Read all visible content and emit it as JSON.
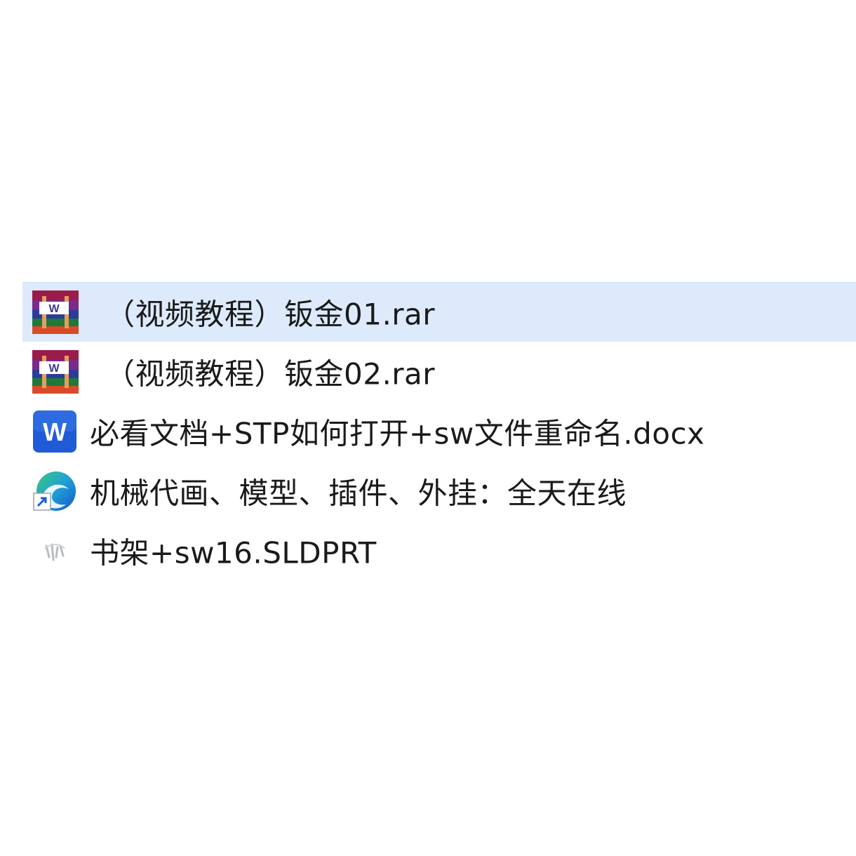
{
  "files": [
    {
      "name": "（视频教程）钣金01.rar",
      "icon": "winrar-archive-icon",
      "selected": true
    },
    {
      "name": "（视频教程）钣金02.rar",
      "icon": "winrar-archive-icon",
      "selected": false
    },
    {
      "name": "必看文档+STP如何打开+sw文件重命名.docx",
      "icon": "word-document-icon",
      "selected": false
    },
    {
      "name": "机械代画、模型、插件、外挂：全天在线",
      "icon": "edge-shortcut-icon",
      "selected": false
    },
    {
      "name": "书架+sw16.SLDPRT",
      "icon": "solidworks-part-icon",
      "selected": false
    }
  ],
  "colors": {
    "selection": "#dceafb",
    "word_blue": "#1f5bd6",
    "text": "#1a1a1a"
  }
}
